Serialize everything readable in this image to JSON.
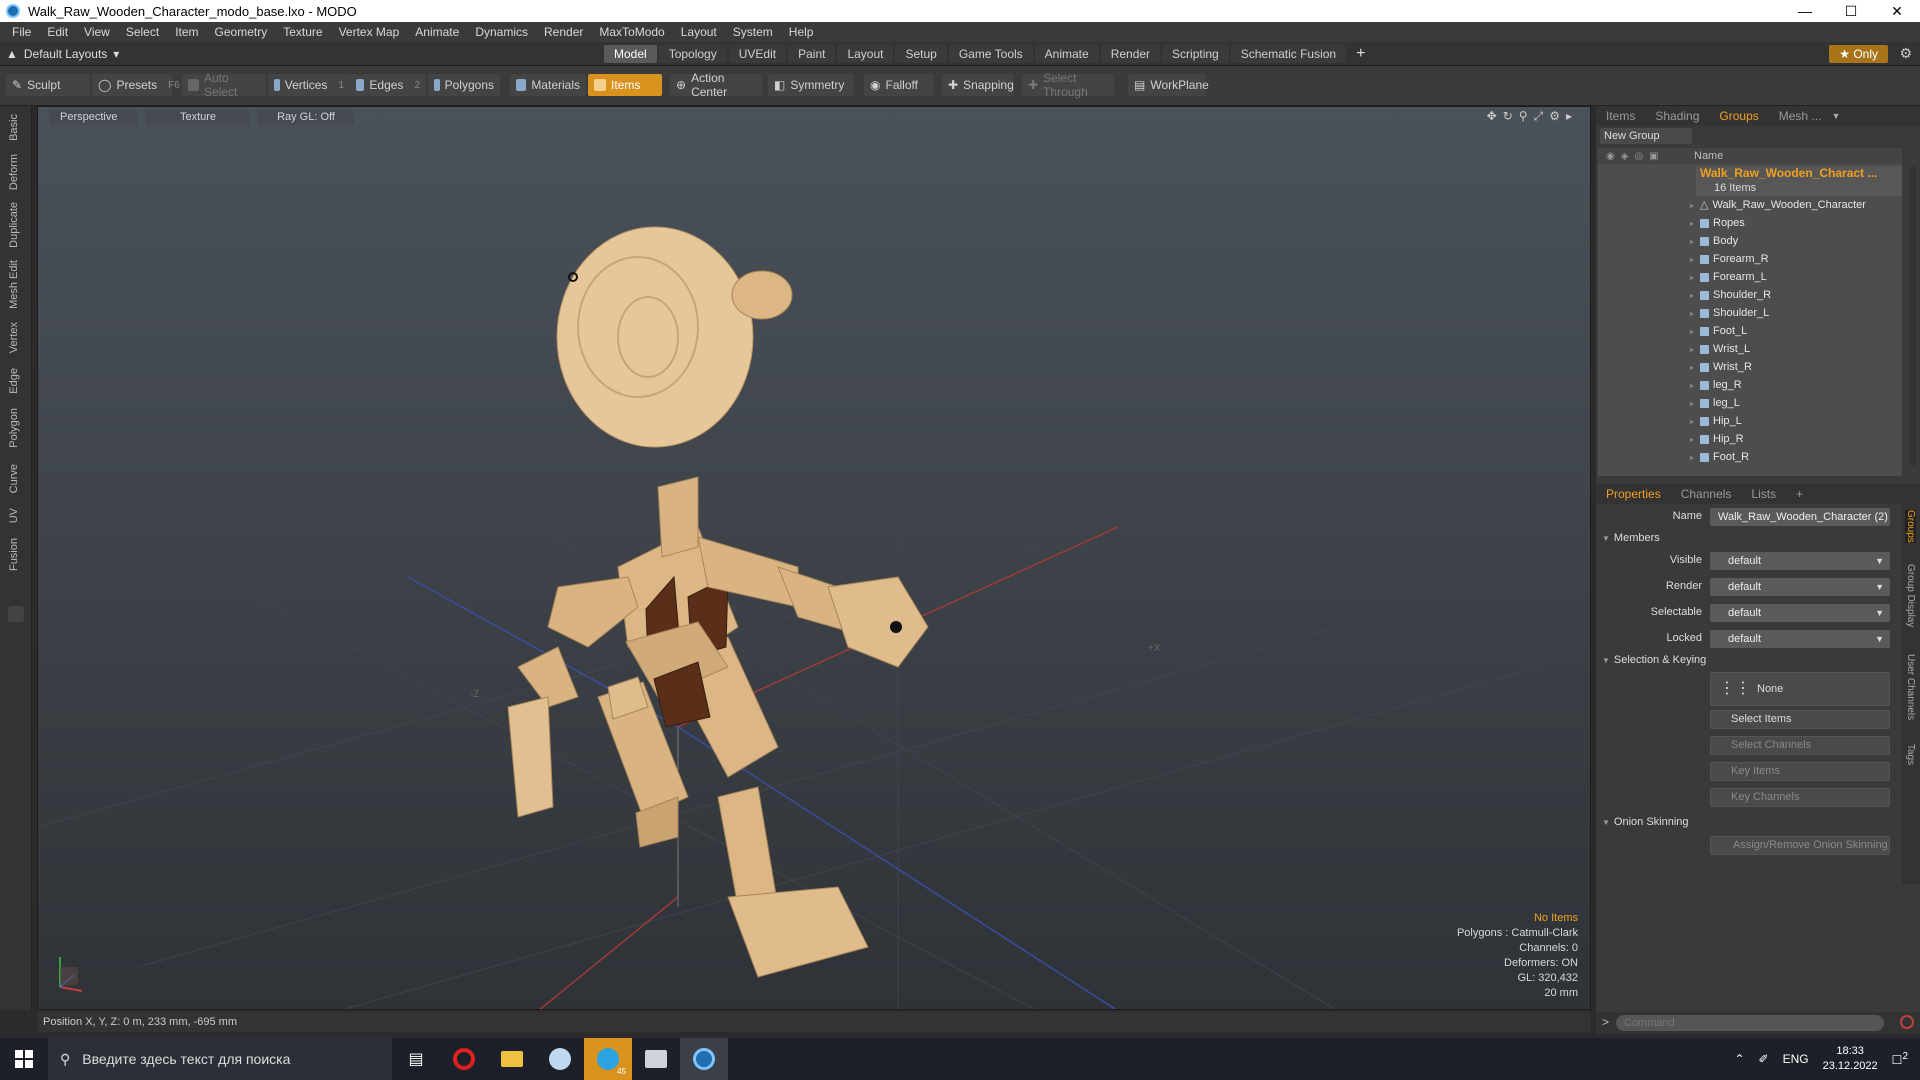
{
  "window": {
    "title": "Walk_Raw_Wooden_Character_modo_base.lxo - MODO",
    "controls": [
      "minimize-icon",
      "maximize-icon",
      "close-icon"
    ]
  },
  "menu": [
    "File",
    "Edit",
    "View",
    "Select",
    "Item",
    "Geometry",
    "Texture",
    "Vertex Map",
    "Animate",
    "Dynamics",
    "Render",
    "MaxToModo",
    "Layout",
    "System",
    "Help"
  ],
  "layout_select": "Default Layouts",
  "tabs": [
    "Model",
    "Topology",
    "UVEdit",
    "Paint",
    "Layout",
    "Setup",
    "Game Tools",
    "Animate",
    "Render",
    "Scripting",
    "Schematic Fusion"
  ],
  "active_tab": "Model",
  "only_label": "Only",
  "toolbar": {
    "sculpt": "Sculpt",
    "presets": "Presets",
    "presets_key": "F6",
    "auto_select": "Auto Select",
    "vertices": "Vertices",
    "vertices_key": "1",
    "edges": "Edges",
    "edges_key": "2",
    "polygons": "Polygons",
    "materials": "Materials",
    "items": "Items",
    "action_center": "Action Center",
    "symmetry": "Symmetry",
    "falloff": "Falloff",
    "snapping": "Snapping",
    "select_through": "Select Through",
    "workplane": "WorkPlane"
  },
  "left_tabs": [
    "Basic",
    "Deform",
    "Duplicate",
    "Mesh Edit",
    "Vertex",
    "Edge",
    "Polygon",
    "Curve",
    "UV",
    "Fusion"
  ],
  "viewport": {
    "view": "Perspective",
    "shading": "Texture",
    "raygl": "Ray GL: Off",
    "info": {
      "items": "No Items",
      "polygons": "Polygons : Catmull-Clark",
      "channels": "Channels: 0",
      "deformers": "Deformers: ON",
      "gl": "GL: 320,432",
      "scale": "20 mm"
    }
  },
  "status": "Position X, Y, Z:   0 m, 233 mm, -695 mm",
  "right_tabs": [
    "Items",
    "Shading",
    "Groups",
    "Mesh ..."
  ],
  "active_right_tab": "Groups",
  "new_group": "New Group",
  "list_header": "Name",
  "group": {
    "name": "Walk_Raw_Wooden_Charact ...",
    "count": "16 Items",
    "members": [
      "Walk_Raw_Wooden_Character",
      "Ropes",
      "Body",
      "Forearm_R",
      "Forearm_L",
      "Shoulder_R",
      "Shoulder_L",
      "Foot_L",
      "Wrist_L",
      "Wrist_R",
      "leg_R",
      "leg_L",
      "Hip_L",
      "Hip_R",
      "Foot_R"
    ]
  },
  "prop_tabs": [
    "Properties",
    "Channels",
    "Lists",
    "+"
  ],
  "properties": {
    "name_label": "Name",
    "name_value": "Walk_Raw_Wooden_Character (2)",
    "members_section": "Members",
    "visible_label": "Visible",
    "visible_value": "default",
    "render_label": "Render",
    "render_value": "default",
    "selectable_label": "Selectable",
    "selectable_value": "default",
    "locked_label": "Locked",
    "locked_value": "default",
    "selkey_section": "Selection & Keying",
    "none_btn": "None",
    "select_items": "Select Items",
    "select_channels": "Select Channels",
    "key_items": "Key Items",
    "key_channels": "Key Channels",
    "onion_section": "Onion Skinning",
    "assign_onion": "Assign/Remove Onion Skinning"
  },
  "side_tabs": [
    "Groups",
    "Group Display",
    "User Channels",
    "Tags"
  ],
  "command_placeholder": "Command",
  "taskbar": {
    "search": "Введите здесь текст для поиска",
    "lang": "ENG",
    "time": "18:33",
    "date": "23.12.2022",
    "notif_count": "2",
    "badge": "45"
  }
}
